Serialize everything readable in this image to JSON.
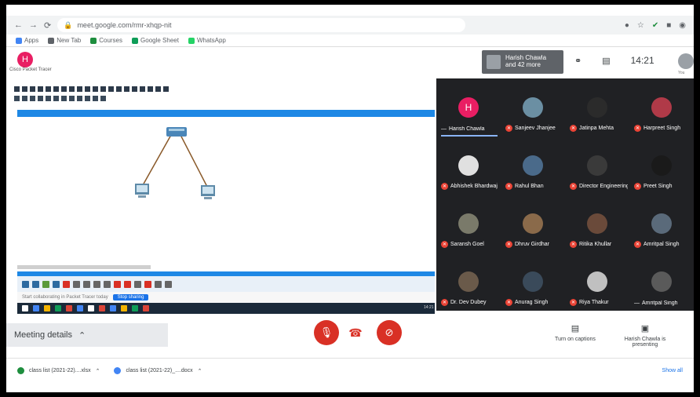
{
  "browser": {
    "url": "meet.google.com/rmr-xhqp-nit",
    "bookmarks": [
      {
        "label": "Apps",
        "color": "#4285f4"
      },
      {
        "label": "New Tab",
        "color": "#5f6368"
      },
      {
        "label": "Courses",
        "color": "#1e8e3e"
      },
      {
        "label": "Google Sheet",
        "color": "#0f9d58"
      },
      {
        "label": "WhatsApp",
        "color": "#25d366"
      }
    ]
  },
  "shared_screen": {
    "presenter_initial": "H",
    "app_title": "Cisco Packet Tracer",
    "message_text": "Start collaborating in Packet Tracer today",
    "message_button": "Stop sharing",
    "taskbar_time": "14:21"
  },
  "meet_header": {
    "presenter_line1": "Harish Chawla",
    "presenter_line2": "and 42 more",
    "clock": "14:21",
    "you_label": "You"
  },
  "participants": [
    {
      "name": "Harish Chawla",
      "initial": "H",
      "color": "#e91e63",
      "muted": false,
      "active": true
    },
    {
      "name": "Sanjeev Jhanjee",
      "initial": "",
      "color": "#6b8fa3",
      "muted": true,
      "active": false
    },
    {
      "name": "Jatinpa Mehta",
      "initial": "",
      "color": "#2b2b2b",
      "muted": true,
      "active": false
    },
    {
      "name": "Harpreet Singh",
      "initial": "",
      "color": "#b03a48",
      "muted": true,
      "active": false
    },
    {
      "name": "Abhishek Bhardwaj",
      "initial": "",
      "color": "#e0e0e0",
      "muted": true,
      "active": false
    },
    {
      "name": "Rahul Bhan",
      "initial": "",
      "color": "#4a6a8a",
      "muted": true,
      "active": false
    },
    {
      "name": "Director Engineering",
      "initial": "",
      "color": "#3a3a3a",
      "muted": true,
      "active": false
    },
    {
      "name": "Preet Singh",
      "initial": "",
      "color": "#1a1a1a",
      "muted": true,
      "active": false
    },
    {
      "name": "Saransh Goel",
      "initial": "",
      "color": "#7a7a6a",
      "muted": true,
      "active": false
    },
    {
      "name": "Dhruv Girdhar",
      "initial": "",
      "color": "#8a6a4a",
      "muted": true,
      "active": false
    },
    {
      "name": "Ritika Khullar",
      "initial": "",
      "color": "#6a4a3a",
      "muted": true,
      "active": false
    },
    {
      "name": "Amritpal Singh",
      "initial": "",
      "color": "#5a6a7a",
      "muted": true,
      "active": false
    },
    {
      "name": "Dr. Dev Dubey",
      "initial": "",
      "color": "#6a5a4a",
      "muted": true,
      "active": false
    },
    {
      "name": "Anurag Singh",
      "initial": "",
      "color": "#3a4a5a",
      "muted": true,
      "active": false
    },
    {
      "name": "Riya Thakur",
      "initial": "",
      "color": "#c0c0c0",
      "muted": true,
      "active": false
    },
    {
      "name": "Amritpal Singh",
      "initial": "",
      "color": "#5a5a5a",
      "muted": false,
      "active": false
    }
  ],
  "bottom_bar": {
    "meeting_details": "Meeting details",
    "captions_label": "Turn on captions",
    "presenting_label": "Harish Chawla is presenting"
  },
  "downloads": {
    "items": [
      {
        "label": "class list (2021-22)....xlsx",
        "color": "#1e8e3e"
      },
      {
        "label": "class list (2021-22)_....docx",
        "color": "#4285f4"
      }
    ],
    "show_all": "Show all"
  }
}
